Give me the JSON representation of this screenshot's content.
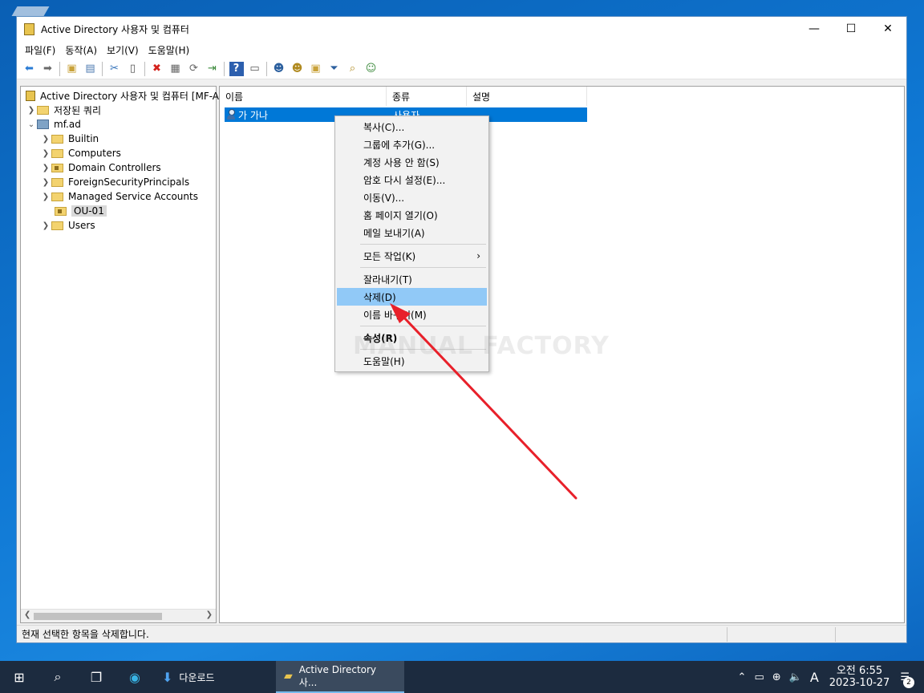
{
  "window": {
    "title": "Active Directory 사용자 및 컴퓨터",
    "controls": {
      "minimize": "—",
      "maximize": "☐",
      "close": "✕"
    }
  },
  "menubar": [
    "파일(F)",
    "동작(A)",
    "보기(V)",
    "도움말(H)"
  ],
  "toolbar_icons": [
    "back-icon",
    "forward-icon",
    "up-folder-icon",
    "show-tree-icon",
    "cut-icon",
    "paste-icon",
    "delete-icon",
    "properties-icon",
    "refresh-icon",
    "export-icon",
    "help-icon",
    "view-icon",
    "add-user-icon",
    "add-group-icon",
    "add-ou-icon",
    "filter-icon",
    "find-icon",
    "delegate-icon"
  ],
  "tree": {
    "root": "Active Directory 사용자 및 컴퓨터 [MF-A",
    "saved_queries": "저장된 쿼리",
    "domain": "mf.ad",
    "children": [
      "Builtin",
      "Computers",
      "Domain Controllers",
      "ForeignSecurityPrincipals",
      "Managed Service Accounts",
      "OU-01",
      "Users"
    ]
  },
  "list": {
    "columns": [
      "이름",
      "종류",
      "설명"
    ],
    "rows": [
      {
        "name": "가 가나",
        "type": "사용자",
        "desc": ""
      }
    ]
  },
  "context_menu": {
    "items": [
      "복사(C)...",
      "그룹에 추가(G)...",
      "계정 사용 안 함(S)",
      "암호 다시 설정(E)...",
      "이동(V)...",
      "홈 페이지 열기(O)",
      "메일 보내기(A)",
      "모든 작업(K)",
      "잘라내기(T)",
      "삭제(D)",
      "이름 바꾸기(M)",
      "속성(R)",
      "도움말(H)"
    ],
    "highlighted": "삭제(D)",
    "submenu_arrow": "›"
  },
  "watermark": "MANUAL FACTORY",
  "statusbar": {
    "text": "현재 선택한 항목을 삭제합니다."
  },
  "taskbar": {
    "apps": [
      "다운로드",
      "Active Directory 사..."
    ],
    "ime": "A",
    "time": "오전 6:55",
    "date": "2023-10-27",
    "notifications": "2"
  },
  "annotation_color": "#e8202a"
}
